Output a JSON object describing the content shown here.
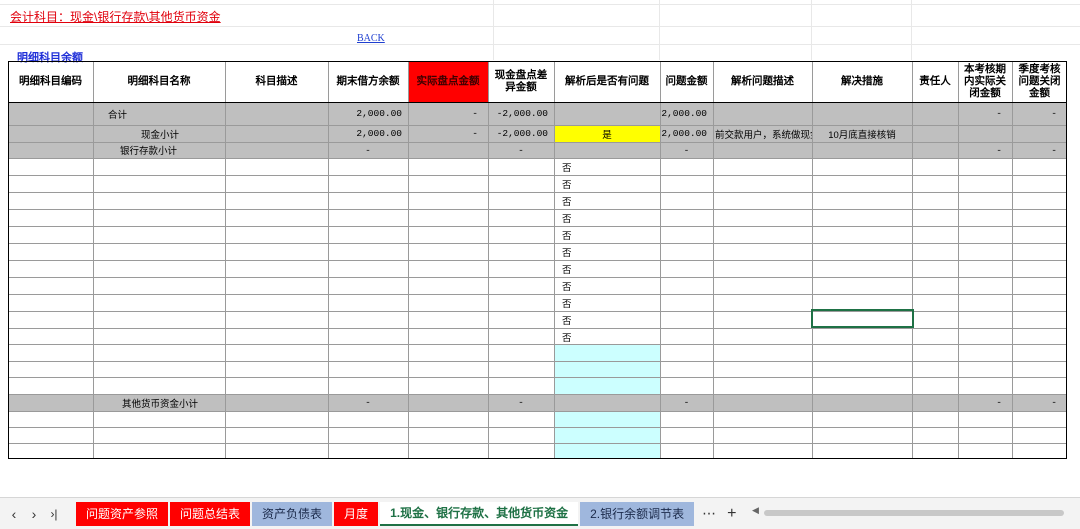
{
  "title": "会计科目：现金\\银行存款\\其他货币资金",
  "back_link": "BACK",
  "section_title": "明细科目余额",
  "headers": {
    "code": "明细科目编码",
    "name": "明细科目名称",
    "desc": "科目描述",
    "end_balance": "期末借方余额",
    "actual_count": "实际盘点金额",
    "diff": "现金盘点差异金额",
    "has_issue": "解析后是否有问题",
    "issue_amount": "问题金额",
    "issue_desc": "解析问题描述",
    "solution": "解决措施",
    "owner": "责任人",
    "period_closed": "本考核期内实际关闭金额",
    "quarter_closed": "季度考核问题关闭金额"
  },
  "rows": {
    "total": {
      "name": "合计",
      "end_balance": "2,000.00",
      "actual_count": "-",
      "diff": "-2,000.00",
      "issue_amount": "2,000.00",
      "period_closed": "-",
      "quarter_closed": "-"
    },
    "cash": {
      "name": "现金小计",
      "end_balance": "2,000.00",
      "actual_count": "-",
      "diff": "-2,000.00",
      "has_issue": "是",
      "issue_amount": "2,000.00",
      "issue_desc": "前交款用户，系统做现金",
      "solution": "10月底直接核销"
    },
    "bank": {
      "name": "银行存款小计",
      "end_balance": "-",
      "diff": "-",
      "issue_amount": "-",
      "period_closed": "-",
      "quarter_closed": "-"
    },
    "no_values": [
      "否",
      "否",
      "否",
      "否",
      "否",
      "否",
      "否",
      "否",
      "否",
      "否",
      "否"
    ],
    "other": {
      "name": "其他货币资金小计",
      "end_balance": "-",
      "diff": "-",
      "issue_amount": "-",
      "period_closed": "-",
      "quarter_closed": "-"
    }
  },
  "sheet_tabs": [
    {
      "label": "问题资产参照",
      "style": "red"
    },
    {
      "label": "问题总结表",
      "style": "red"
    },
    {
      "label": "资产负债表",
      "style": "blue"
    },
    {
      "label": "月度",
      "style": "red"
    },
    {
      "label": "1.现金、银行存款、其他货币资金",
      "style": "active"
    },
    {
      "label": "2.银行余额调节表",
      "style": "blue"
    }
  ],
  "tab_more": "⋯",
  "tab_add": "+",
  "colors": {
    "title_red": "#e0000c",
    "link_blue": "#1f3fd0",
    "header_red": "#ff0000",
    "subtotal_gray": "#bfbfbf",
    "highlight_yellow": "#ffff00",
    "input_cyan": "#ccffff",
    "selection_green": "#1e7145"
  }
}
